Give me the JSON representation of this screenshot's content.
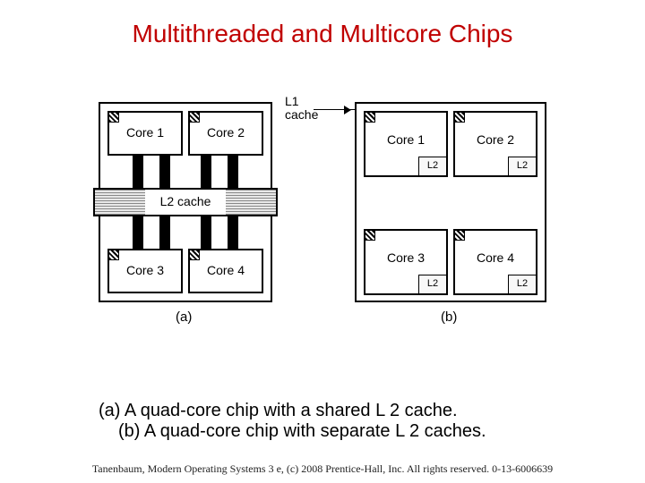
{
  "title": "Multithreaded and Multicore Chips",
  "l1_callout": "L1\ncache",
  "chip_a": {
    "cores": [
      "Core 1",
      "Core 2",
      "Core 3",
      "Core 4"
    ],
    "l2_label": "L2 cache",
    "sublabel": "(a)"
  },
  "chip_b": {
    "cores": [
      "Core 1",
      "Core 2",
      "Core 3",
      "Core 4"
    ],
    "l2_label": "L2",
    "sublabel": "(b)"
  },
  "caption": {
    "line_a": "(a) A quad-core chip with a shared L 2 cache.",
    "line_b": "(b) A quad-core chip with separate L 2 caches."
  },
  "footer": "Tanenbaum, Modern Operating Systems 3 e, (c) 2008 Prentice-Hall, Inc. All rights reserved. 0-13-6006639"
}
